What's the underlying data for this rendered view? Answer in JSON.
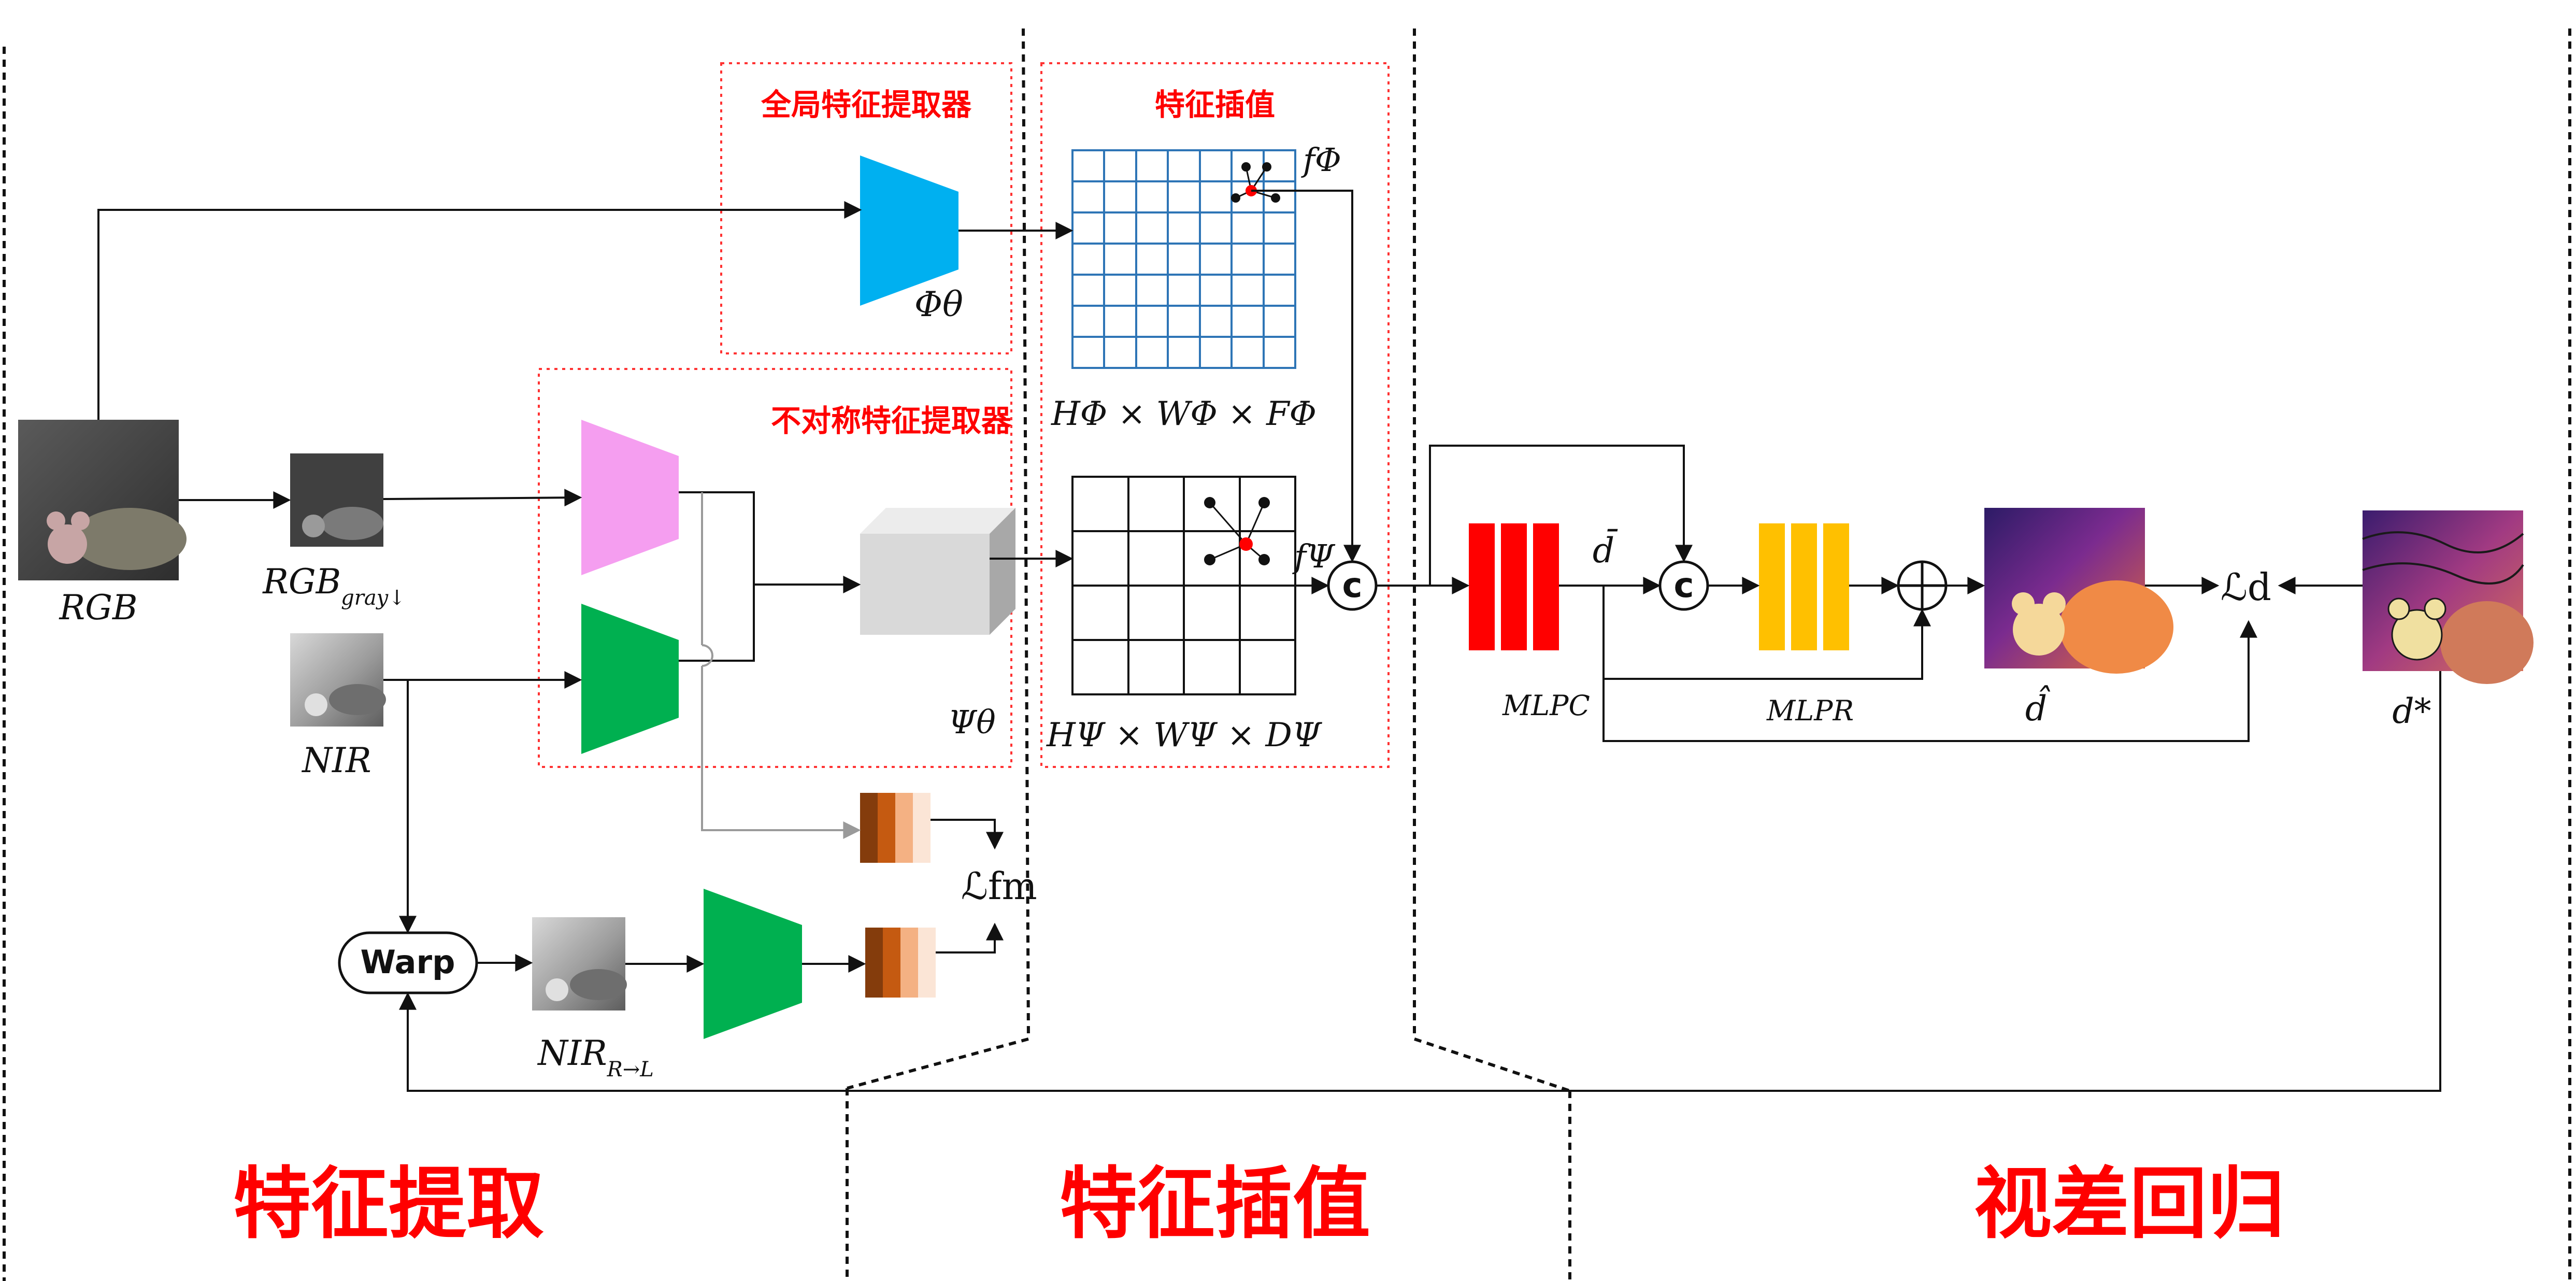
{
  "box_titles": {
    "global_extractor": "全局特征提取器",
    "feature_interp_box": "特征插值",
    "asym_extractor": "不对称特征提取器"
  },
  "section_titles": {
    "extraction": "特征提取",
    "interpolation": "特征插值",
    "regression": "视差回归"
  },
  "labels": {
    "rgb": "RGB",
    "rgb_gray_base": "RGB",
    "rgb_gray_sub": "gray↓",
    "nir": "NIR",
    "nir_rl_base": "NIR",
    "nir_rl_sub": "R→L",
    "phi_theta": "Φθ",
    "psi_theta": "Ψθ",
    "grid_phi_caption": "HΦ × WΦ × FΦ",
    "grid_psi_caption": "HΨ × WΨ × DΨ",
    "f_phi": "fΦ",
    "f_psi": "fΨ",
    "warp": "Warp",
    "concat_symbol": "c",
    "loss_fm": "ℒfm",
    "mlp_c": "MLPC",
    "mlp_r": "MLPR",
    "d_bar": "d̄",
    "d_hat": "d̂",
    "d_star": "d*",
    "loss_d": "ℒd"
  },
  "colors": {
    "title_red": "#ff0000",
    "encoder_blue": "#00b0f0",
    "encoder_pink": "#f59ef0",
    "encoder_green": "#00b050",
    "grid_blue": "#2e75b6",
    "mlp_red": "#ff0000",
    "mlp_yellow": "#ffc000",
    "sample_red": "#ff0000",
    "arrow_gray": "#9a9a9a",
    "volume_gray": "#d9d9d9"
  },
  "icons": {
    "concat": "circled-c-icon",
    "sum": "circled-plus-icon"
  }
}
